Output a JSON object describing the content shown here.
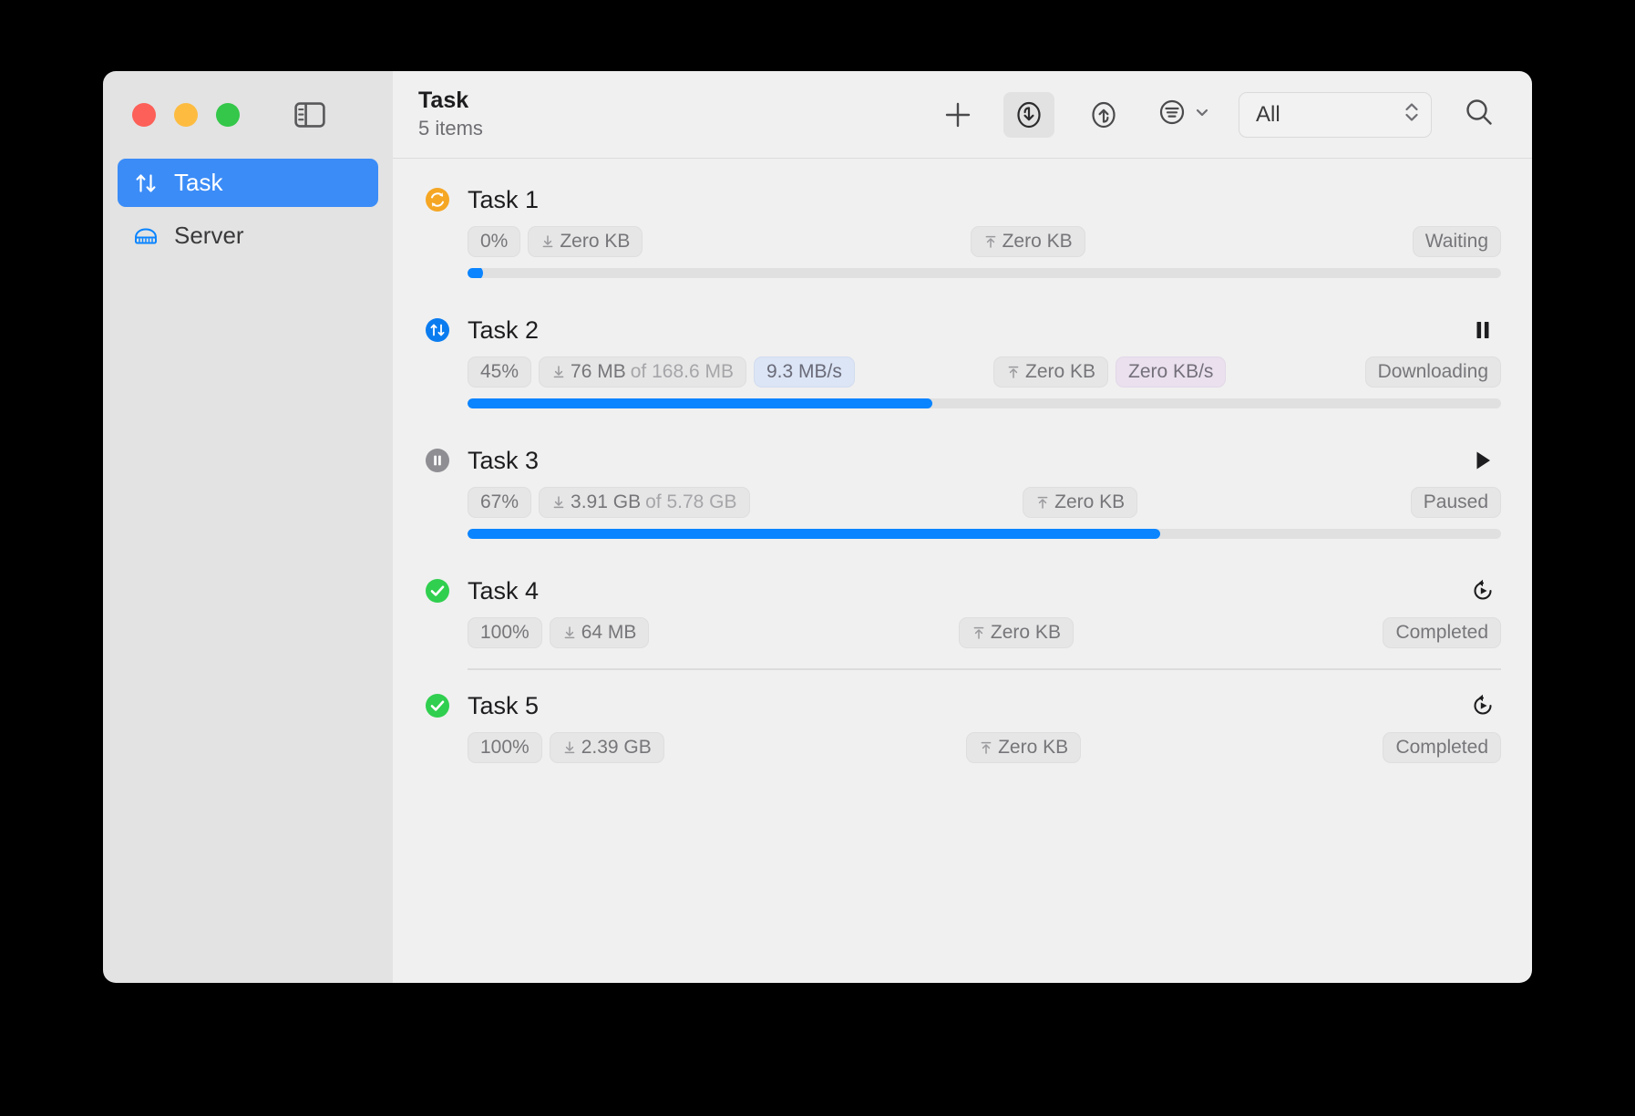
{
  "window": {
    "traffic_lights": [
      "close",
      "minimize",
      "maximize"
    ],
    "sidebar_toggle_icon": "sidebar-toggle-icon"
  },
  "sidebar": {
    "items": [
      {
        "label": "Task",
        "icon": "up-down-arrows-icon",
        "active": true
      },
      {
        "label": "Server",
        "icon": "server-rack-icon",
        "active": false
      }
    ]
  },
  "toolbar": {
    "title": "Task",
    "subtitle": "5 items",
    "add_label": "+",
    "download_filter_icon": "download-circle-icon",
    "upload_filter_icon": "upload-circle-icon",
    "sort_icon": "sort-lines-circle-icon",
    "sort_chevron": "chevron-down-icon",
    "select_value": "All",
    "stepper_icon": "stepper-updown-icon",
    "search_icon": "search-icon"
  },
  "tasks": [
    {
      "name": "Task 1",
      "status_icon": "refresh-circle-orange-icon",
      "percent": "0%",
      "down_label": "Zero KB",
      "down_total": "",
      "down_speed": "",
      "up_label": "Zero KB",
      "up_speed": "",
      "state": "Waiting",
      "progress": 0,
      "action_icon": "",
      "show_bar": true,
      "show_dot": true,
      "show_divider": false
    },
    {
      "name": "Task 2",
      "status_icon": "transfer-circle-blue-icon",
      "percent": "45%",
      "down_label": "76 MB",
      "down_total": "of 168.6 MB",
      "down_speed": "9.3 MB/s",
      "up_label": "Zero KB",
      "up_speed": "Zero KB/s",
      "state": "Downloading",
      "progress": 45,
      "action_icon": "pause-icon",
      "show_bar": true,
      "show_dot": false,
      "show_divider": false
    },
    {
      "name": "Task 3",
      "status_icon": "pause-circle-gray-icon",
      "percent": "67%",
      "down_label": "3.91 GB",
      "down_total": "of 5.78 GB",
      "down_speed": "",
      "up_label": "Zero KB",
      "up_speed": "",
      "state": "Paused",
      "progress": 67,
      "action_icon": "play-icon",
      "show_bar": true,
      "show_dot": false,
      "show_divider": false
    },
    {
      "name": "Task 4",
      "status_icon": "check-circle-green-icon",
      "percent": "100%",
      "down_label": "64 MB",
      "down_total": "",
      "down_speed": "",
      "up_label": "Zero KB",
      "up_speed": "",
      "state": "Completed",
      "progress": 100,
      "action_icon": "restart-icon",
      "show_bar": false,
      "show_dot": false,
      "show_divider": true
    },
    {
      "name": "Task 5",
      "status_icon": "check-circle-green-icon",
      "percent": "100%",
      "down_label": "2.39 GB",
      "down_total": "",
      "down_speed": "",
      "up_label": "Zero KB",
      "up_speed": "",
      "state": "Completed",
      "progress": 100,
      "action_icon": "restart-icon",
      "show_bar": false,
      "show_dot": false,
      "show_divider": false
    }
  ],
  "colors": {
    "accent_blue": "#0a84ff",
    "sidebar_selected": "#3b8cf7",
    "orange": "#f5a623",
    "green": "#30cf4f",
    "gray": "#8e8e93"
  }
}
